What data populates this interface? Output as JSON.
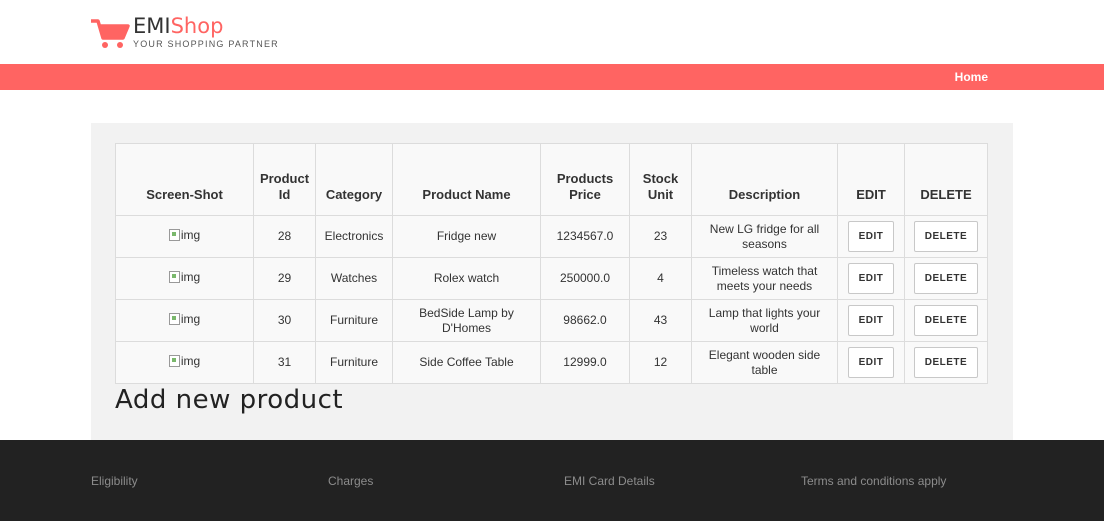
{
  "brand": {
    "name_part1": "EMI",
    "name_part2": "Shop",
    "tagline": "YOUR SHOPPING PARTNER",
    "accent_color": "#ff6462"
  },
  "nav": {
    "home": "Home"
  },
  "table": {
    "headers": [
      "Screen-Shot",
      "Product Id",
      "Category",
      "Product Name",
      "Products Price",
      "Stock Unit",
      "Description",
      "EDIT",
      "DELETE"
    ],
    "rows": [
      {
        "img_alt": "img",
        "id": "28",
        "category": "Electronics",
        "name": "Fridge new",
        "price": "1234567.0",
        "stock": "23",
        "description": "New LG fridge for all seasons",
        "edit": "EDIT",
        "delete": "DELETE"
      },
      {
        "img_alt": "img",
        "id": "29",
        "category": "Watches",
        "name": "Rolex watch",
        "price": "250000.0",
        "stock": "4",
        "description": "Timeless watch that meets your needs",
        "edit": "EDIT",
        "delete": "DELETE"
      },
      {
        "img_alt": "img",
        "id": "30",
        "category": "Furniture",
        "name": "BedSide Lamp by D'Homes",
        "price": "98662.0",
        "stock": "43",
        "description": "Lamp that lights your world",
        "edit": "EDIT",
        "delete": "DELETE"
      },
      {
        "img_alt": "img",
        "id": "31",
        "category": "Furniture",
        "name": "Side Coffee Table",
        "price": "12999.0",
        "stock": "12",
        "description": "Elegant wooden side table",
        "edit": "EDIT",
        "delete": "DELETE"
      }
    ]
  },
  "add_product": {
    "title": "Add new product"
  },
  "footer": {
    "links": [
      "Eligibility",
      "Charges",
      "EMI Card Details",
      "Terms and conditions apply"
    ]
  }
}
